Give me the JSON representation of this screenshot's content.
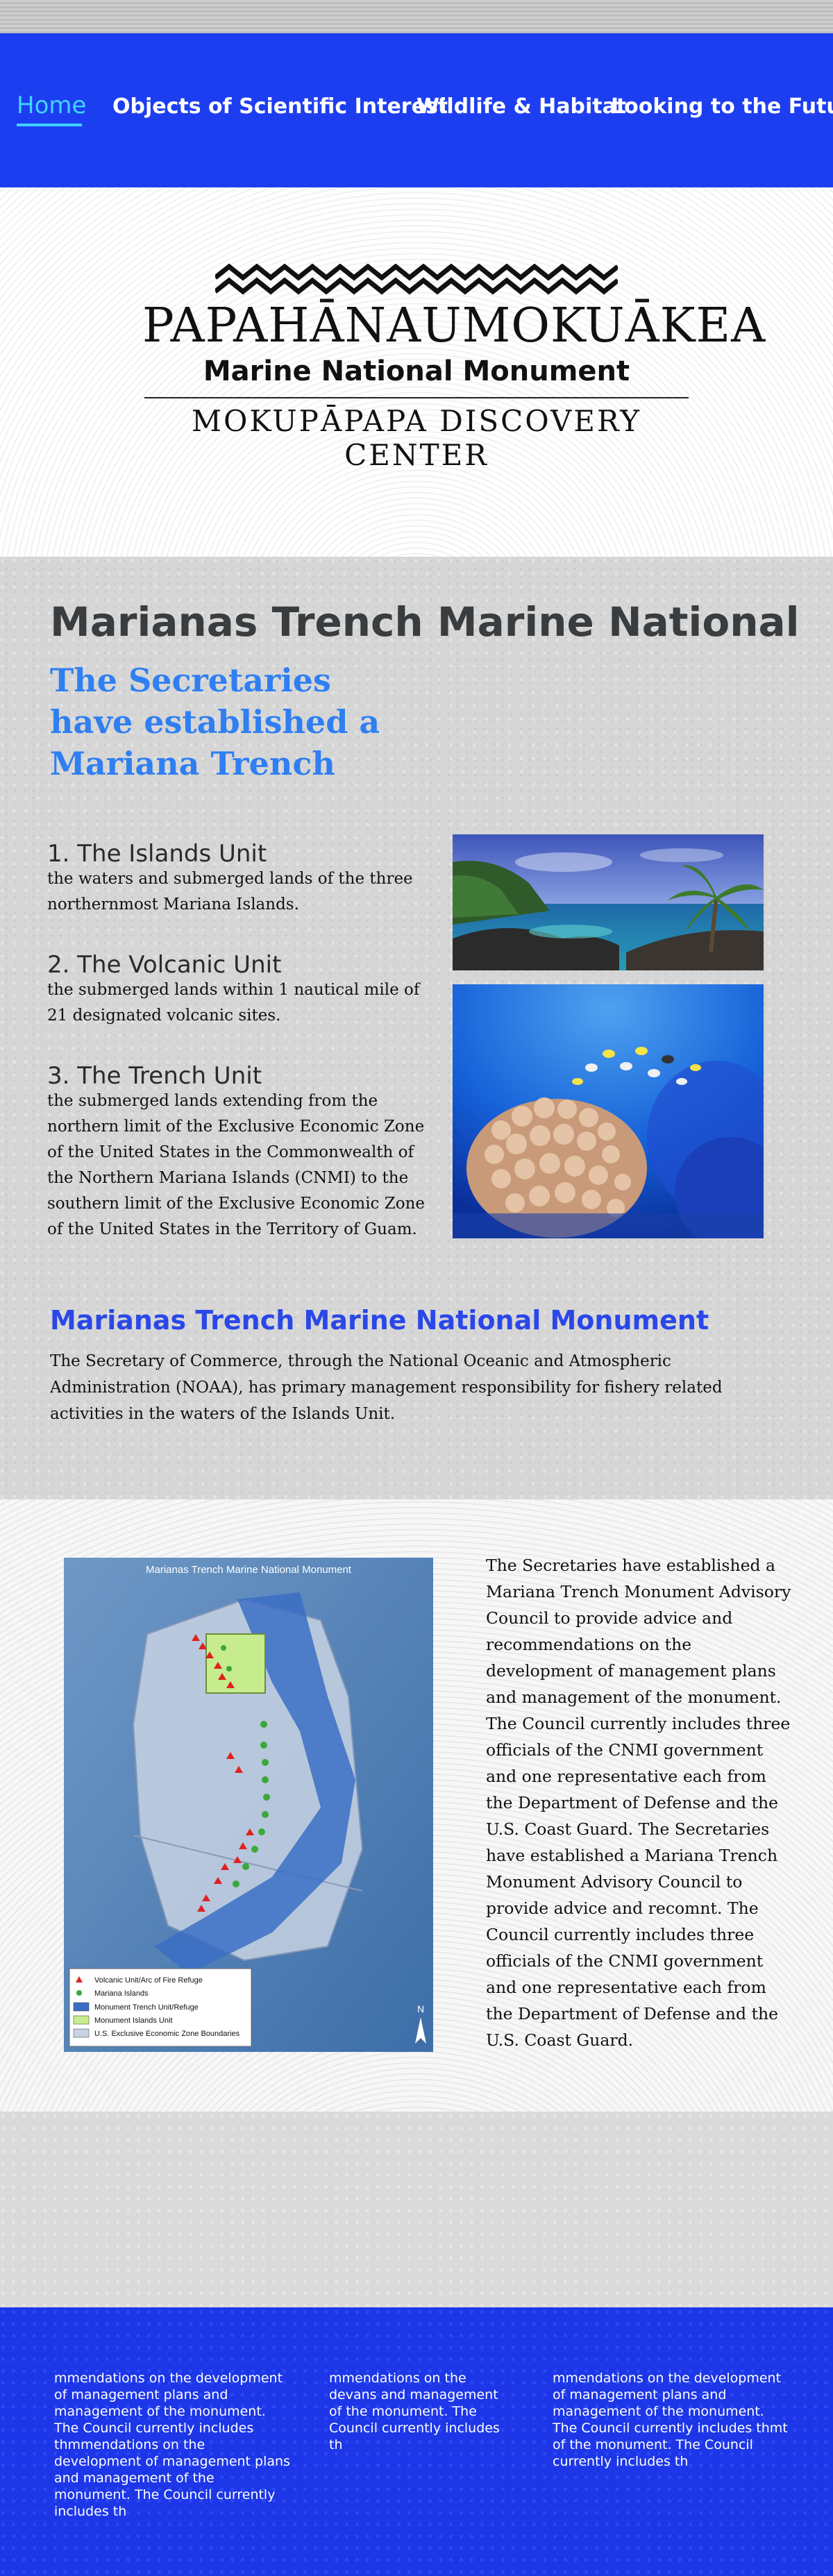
{
  "nav": {
    "items": [
      {
        "label": "Home",
        "active": true
      },
      {
        "label": "Objects of Scientific Interest",
        "active": false
      },
      {
        "label": "Wildlife & Habitat",
        "active": false
      },
      {
        "label": "Looking to the Future",
        "active": false
      }
    ]
  },
  "logo": {
    "title": "PAPAHĀNAUMOKUĀKEA",
    "subtitle": "Marine National Monument",
    "center": "MOKUPĀPAPA DISCOVERY CENTER"
  },
  "intro": {
    "title": "Marianas Trench Marine National",
    "heading": "The Secretaries have established a Mariana Trench",
    "units": [
      {
        "title": "1. The Islands Unit",
        "text": "the waters and submerged lands of the three northernmost Mariana Islands."
      },
      {
        "title": "2. The Volcanic Unit",
        "text": "the submerged lands within 1 nautical mile of 21 designated volcanic sites."
      },
      {
        "title": "3. The Trench Unit",
        "text": "the submerged lands extending from the northern limit of the Exclusive Economic Zone of the United States in the Commonwealth of the Northern Mariana Islands (CNMI) to the southern limit of the Exclusive Economic Zone of the United States in the Territory of Guam."
      }
    ],
    "subheading": "Marianas Trench Marine National Monument",
    "paragraph": "The Secretary of Commerce, through the National Oceanic and Atmospheric Administration (NOAA), has primary management responsibility for fishery related activities in the waters of the Islands Unit."
  },
  "map": {
    "title": "Marianas Trench Marine National Monument",
    "legend": [
      {
        "label": "Volcanic Unit/Arc of Fire Refuge",
        "color": "#e02020"
      },
      {
        "label": "Mariana Islands",
        "color": "#3aa83a"
      },
      {
        "label": "Monument Trench Unit/Refuge",
        "color": "#3b6fc4"
      },
      {
        "label": "Monument Islands Unit",
        "color": "#c6ec8e"
      },
      {
        "label": "U.S. Exclusive Economic Zone Boundaries",
        "color": "#c8d3e3"
      }
    ],
    "north": "N"
  },
  "advisory": {
    "text": "The Secretaries have established a Mariana Trench Monument Advisory Council to provide advice and recommendations on the development of management plans and management of the monument. The Council currently includes three officials of the CNMI government and one representative each from the Department of Defense and the U.S. Coast Guard. The Secretaries have established a Mariana Trench Monument Advisory Council to provide advice and recomnt. The Council currently includes three officials of the CNMI government and one representative each from the Department of Defense and the U.S. Coast Guard."
  },
  "footer": {
    "columns": [
      "mmendations on the development of management plans and management of the monument. The Council currently includes thmmendations on the development of management plans and management of the monument. The Council currently includes th",
      "mmendations on the devans and management of the monument. The Council currently includes th",
      "mmendations on the development of management plans and management of the monument. The Council currently includes thmt of the monument. The Council currently includes th"
    ]
  },
  "colors": {
    "nav_bg": "#1d3ef0",
    "nav_active": "#3fd4ff",
    "heading_blue": "#2f7ff2",
    "subheading_blue": "#2a47e8",
    "footer_bg": "#1c36e8"
  }
}
